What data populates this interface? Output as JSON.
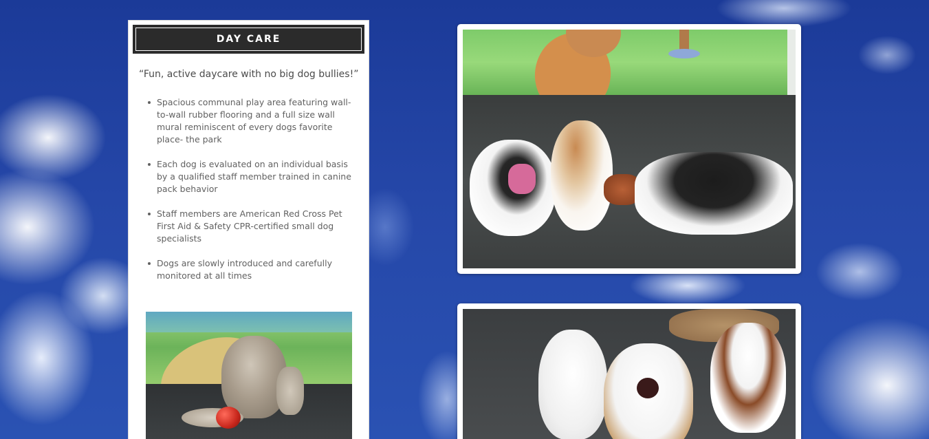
{
  "panel": {
    "title": "DAY CARE",
    "quote": "“Fun, active daycare with no big dog bullies!”",
    "bullets": [
      "Spacious communal play area featuring wall-to-wall rubber flooring and a full size wall mural reminiscent of every dogs favorite place- the park",
      "Each dog is evaluated on an individual basis by a qualified staff member trained in canine pack behavior",
      "Staff members are American Red Cross Pet First Aid & Safety CPR-certified small dog specialists",
      "Dogs are slowly introduced and carefully monitored at all times"
    ]
  },
  "photos": [
    {
      "id": "panel-photo",
      "subject": "shaggy dog with red ball"
    },
    {
      "id": "right-photo-top",
      "subject": "three spaniels playing tug"
    },
    {
      "id": "right-photo-bottom",
      "subject": "small white dogs barking"
    }
  ],
  "colors": {
    "sky": "#1f3c96",
    "header_bg": "#2b2b2b",
    "text": "#616161"
  }
}
